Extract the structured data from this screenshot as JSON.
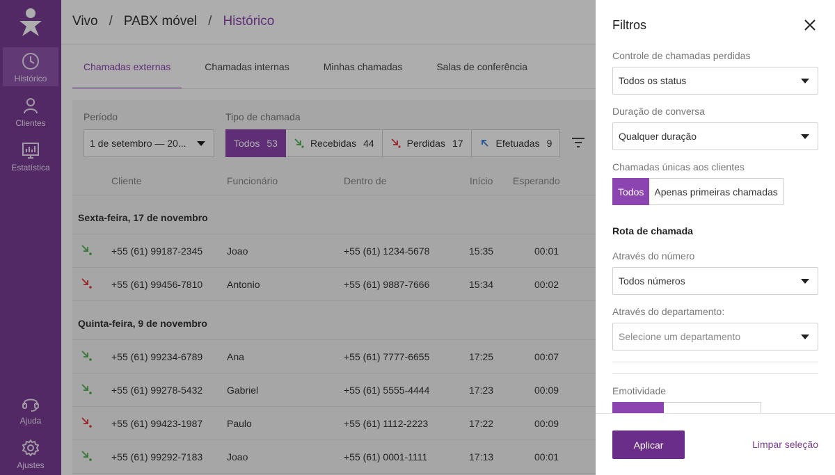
{
  "colors": {
    "brand": "#7a3d96",
    "accent": "#8c45b0",
    "received": "#4caf50",
    "missed": "#e0393e",
    "outgoing": "#2f7fd1"
  },
  "sidebar": {
    "items": [
      {
        "label": "Histórico",
        "icon": "clock-icon"
      },
      {
        "label": "Clientes",
        "icon": "person-icon"
      },
      {
        "label": "Estatística",
        "icon": "chart-icon"
      },
      {
        "label": "Ajuda",
        "icon": "headset-icon"
      },
      {
        "label": "Ajustes",
        "icon": "gear-icon"
      }
    ]
  },
  "breadcrumb": {
    "items": [
      "Vivo",
      "PABX móvel",
      "Histórico"
    ],
    "separator": "/"
  },
  "tabs": [
    "Chamadas externas",
    "Chamadas internas",
    "Minhas chamadas",
    "Salas de conferência"
  ],
  "filters": {
    "period_label": "Período",
    "period_value": "1 de setembro — 20...",
    "call_type_label": "Tipo de chamada",
    "call_types": [
      {
        "label": "Todos",
        "count": "53"
      },
      {
        "label": "Recebidas",
        "count": "44"
      },
      {
        "label": "Perdidas",
        "count": "17"
      },
      {
        "label": "Efetuadas",
        "count": "9"
      }
    ]
  },
  "table": {
    "headers": {
      "client": "Cliente",
      "employee": "Funcionário",
      "inside": "Dentro de",
      "start": "Início",
      "waiting": "Esperando"
    },
    "groups": [
      {
        "title": "Sexta-feira, 17 de novembro",
        "rows": [
          {
            "type": "received",
            "client": "+55 (61) 99187-2345",
            "employee": "Joao",
            "inside": "+55 (61) 1234-5678",
            "start": "15:35",
            "waiting": "00:01"
          },
          {
            "type": "missed",
            "client": "+55 (61) 99456-7810",
            "employee": "Antonio",
            "inside": "+55 (61) 9887-7666",
            "start": "15:34",
            "waiting": "00:02"
          }
        ]
      },
      {
        "title": "Quinta-feira, 9 de novembro",
        "rows": [
          {
            "type": "received",
            "client": "+55 (61) 99234-6789",
            "employee": "Ana",
            "inside": "+55 (61) 7777-6655",
            "start": "17:25",
            "waiting": "00:07"
          },
          {
            "type": "received",
            "client": "+55 (61) 99278-5432",
            "employee": "Gabriel",
            "inside": "+55 (61) 5555-4444",
            "start": "17:23",
            "waiting": "00:09"
          },
          {
            "type": "missed",
            "client": "+55 (61) 99423-1987",
            "employee": "Paulo",
            "inside": "+55 (61) 1112-2223",
            "start": "17:22",
            "waiting": "00:09"
          },
          {
            "type": "received",
            "client": "+55 (61) 99292-7183",
            "employee": "Joao",
            "inside": "+55 (61) 0001-1111",
            "start": "17:13",
            "waiting": "00:01"
          }
        ]
      }
    ]
  },
  "panel": {
    "title": "Filtros",
    "missed_control_label": "Controle de chamadas perdidas",
    "missed_control_value": "Todos os status",
    "duration_label": "Duração de conversa",
    "duration_value": "Qualquer duração",
    "unique_label": "Chamadas únicas aos clientes",
    "unique_options": [
      "Todos",
      "Apenas primeiras chamadas"
    ],
    "route_title": "Rota de chamada",
    "number_label": "Através do número",
    "number_value": "Todos números",
    "department_label": "Através do departamento:",
    "department_placeholder": "Selecione um departamento",
    "emotion_label": "Emotividade",
    "apply_label": "Aplicar",
    "clear_label": "Limpar seleção"
  }
}
